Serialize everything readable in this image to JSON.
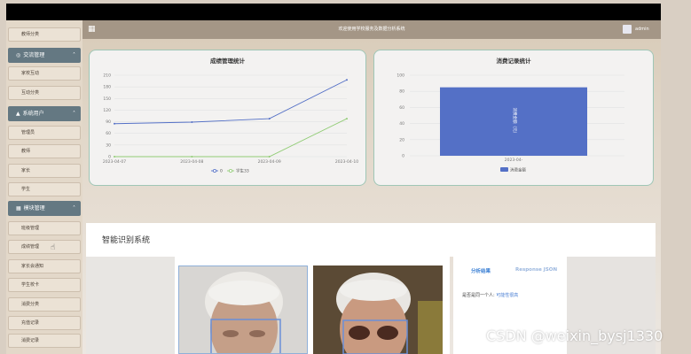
{
  "header": {
    "title": "欢迎使用学校服务及数据分析系统",
    "user": "admin"
  },
  "sidebar": [
    {
      "type": "item",
      "label": "教师分类"
    },
    {
      "type": "group",
      "label": "交流管理",
      "icon": "chat-icon"
    },
    {
      "type": "item",
      "label": "家校互动"
    },
    {
      "type": "item",
      "label": "互动分类"
    },
    {
      "type": "group",
      "label": "系统用户",
      "icon": "user-icon"
    },
    {
      "type": "item",
      "label": "管理员"
    },
    {
      "type": "item",
      "label": "教师"
    },
    {
      "type": "item",
      "label": "家长"
    },
    {
      "type": "item",
      "label": "学生"
    },
    {
      "type": "group",
      "label": "模块管理",
      "icon": "grid-icon"
    },
    {
      "type": "item",
      "label": "班级管理"
    },
    {
      "type": "item",
      "label": "成绩管理"
    },
    {
      "type": "item",
      "label": "家长会通知"
    },
    {
      "type": "item",
      "label": "学生校卡"
    },
    {
      "type": "item",
      "label": "消费分类"
    },
    {
      "type": "item",
      "label": "充值记录"
    },
    {
      "type": "item",
      "label": "消费记录"
    }
  ],
  "chart_data": [
    {
      "type": "line",
      "title": "成绩管理统计",
      "x": [
        "2023-04-07",
        "2023-04-08",
        "2023-04-09",
        "2023-04-10"
      ],
      "yticks": [
        0,
        30,
        60,
        90,
        120,
        150,
        180,
        210
      ],
      "ylim": [
        0,
        210
      ],
      "series": [
        {
          "name": "0",
          "values": [
            85,
            89,
            98,
            198
          ],
          "color": "#5470c6"
        },
        {
          "name": "学生33",
          "values": [
            0,
            0,
            0,
            98
          ],
          "color": "#91cc75"
        }
      ],
      "legend": "bottom",
      "grid": true
    },
    {
      "type": "bar",
      "title": "消费记录统计",
      "categories": [
        "2023-04-"
      ],
      "yticks": [
        0,
        20,
        40,
        60,
        80,
        100
      ],
      "ylim": [
        0,
        100
      ],
      "series": [
        {
          "name": "消费金额",
          "values": [
            85
          ],
          "color": "#5470c6"
        }
      ],
      "bar_label": "消费金额（元）",
      "legend": "bottom",
      "grid": true
    }
  ],
  "panel": {
    "title": "智能识别系统",
    "tabs": [
      "分析结果",
      "Response JSON"
    ],
    "result_label": "是否是同一个人:",
    "result_value": "可能性很高"
  },
  "watermark": "CSDN @weixin_bysj1330",
  "colors": {
    "sidebar_group": "#647882",
    "header": "#a49686",
    "accent": "#5470c6",
    "series2": "#91cc75"
  }
}
